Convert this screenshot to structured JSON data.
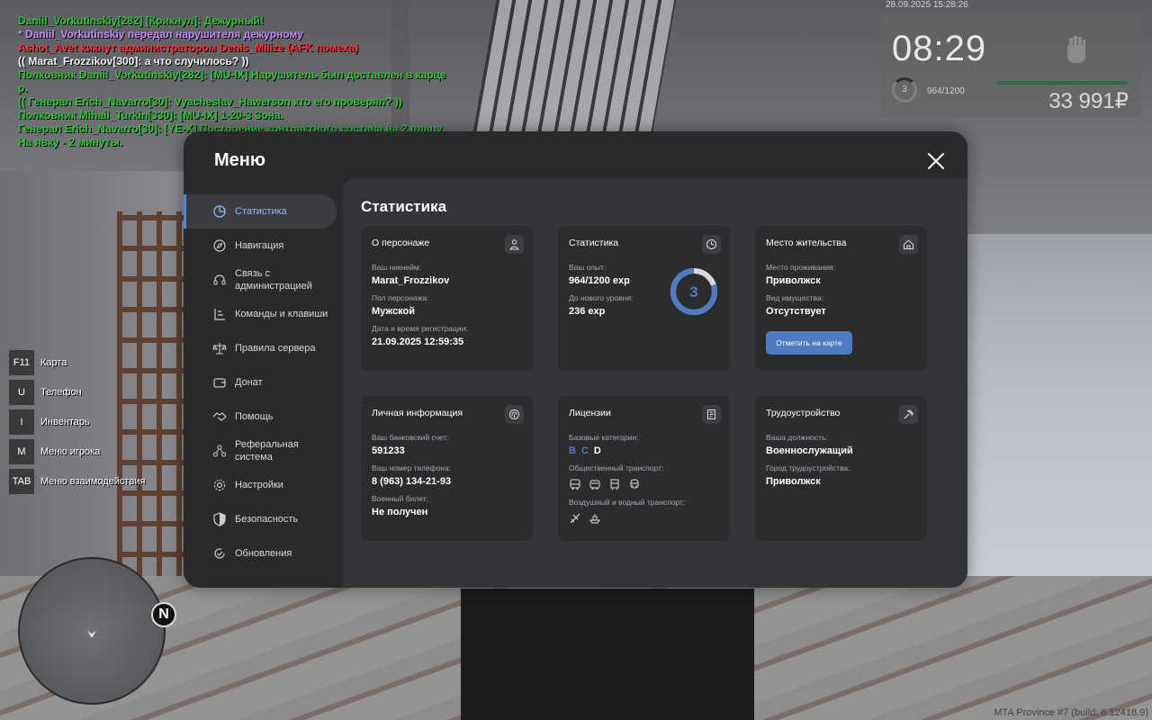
{
  "chat": [
    {
      "text": "Daniil_Vorkutinskiy[282] [Крикнул]: Дежурный!",
      "color": "green"
    },
    {
      "text": "* Daniil_Vorkutinskiy передал нарушителя дежурному",
      "color": "purple"
    },
    {
      "text": "Ashot_Avet кикнут администратором Denis_Milize (AFK помеха)",
      "color": "red"
    },
    {
      "text": "(( Marat_Frozzikov[300]: а что случилось? ))",
      "color": "white"
    },
    {
      "text": "Полковник Daniil_Vorkutinskiy[282]: [MU-IX] Нарушитель был доставлен в карце",
      "color": "green"
    },
    {
      "text": "р.",
      "color": "green"
    },
    {
      "text": "(( Генерал Erich_Navarro[30]: Vyacheslav_Hawerson кто его проверял? ))",
      "color": "green"
    },
    {
      "text": "Полковник Mihail_Turkin[330]: [MU-IX] 1-20-3 Зона.",
      "color": "green"
    },
    {
      "text": "Генерал Erich_Navarro[30]: [YE-X] Построение контрактного состава на 2 плацу.",
      "color": "green"
    },
    {
      "text": " На явку - 2 минуты.",
      "color": "green"
    }
  ],
  "hud": {
    "date": "28.09.2025 15:28:26",
    "time": "08:29",
    "level": "3",
    "exp": "964/1200",
    "money": "33 991₽"
  },
  "keys": [
    {
      "key": "F11",
      "label": "Карта"
    },
    {
      "key": "U",
      "label": "Телефон"
    },
    {
      "key": "I",
      "label": "Инвентарь"
    },
    {
      "key": "M",
      "label": "Меню игрока"
    },
    {
      "key": "TAB",
      "label": "Меню взаимодействия"
    }
  ],
  "minimap": {
    "north": "N"
  },
  "footer": "MTA Province #7 (build: 6.12418.9)",
  "menu": {
    "title": "Меню",
    "nav": [
      {
        "label": "Статистика",
        "icon": "pie-chart-icon"
      },
      {
        "label": "Навигация",
        "icon": "compass-icon"
      },
      {
        "label": "Связь с",
        "label2": "администрацией",
        "icon": "headset-icon"
      },
      {
        "label": "Команды и клавиши",
        "icon": "command-icon"
      },
      {
        "label": "Правила сервера",
        "icon": "scales-icon"
      },
      {
        "label": "Донат",
        "icon": "wallet-icon"
      },
      {
        "label": "Помощь",
        "icon": "handshake-icon"
      },
      {
        "label": "Реферальная",
        "label2": "система",
        "icon": "referral-icon"
      },
      {
        "label": "Настройки",
        "icon": "gear-icon"
      },
      {
        "label": "Безопасность",
        "icon": "shield-icon"
      },
      {
        "label": "Обновления",
        "icon": "refresh-icon"
      }
    ],
    "content_title": "Статистика",
    "about": {
      "title": "О персонаже",
      "nick_label": "Ваш никнейм:",
      "nick": "Marat_Frozzikov",
      "gender_label": "Пол персонажа:",
      "gender": "Мужской",
      "reg_label": "Дата и время регистрации:",
      "reg": "21.09.2025 12:59:35"
    },
    "stats": {
      "title": "Статистика",
      "exp_label": "Ваш опыт:",
      "exp": "964/1200 exp",
      "next_label": "До нового уровня:",
      "next": "236 exp",
      "level": "3",
      "progress": 0.803
    },
    "residence": {
      "title": "Место жительства",
      "place_label": "Место проживания:",
      "place": "Приволжск",
      "property_label": "Вид имущества:",
      "property": "Отсутствует",
      "button": "Отметить на карте"
    },
    "personal": {
      "title": "Личная информация",
      "bank_label": "Ваш банковский счет:",
      "bank": "591233",
      "phone_label": "Ваш номер телефона:",
      "phone": "8 (963) 134-21-93",
      "military_label": "Военный билет:",
      "military": "Не получен"
    },
    "licenses": {
      "title": "Лицензии",
      "base_label": "Базовые категории:",
      "cat_b": "B",
      "cat_c": "C",
      "cat_d": "D",
      "public_label": "Общественный транспорт:",
      "air_label": "Воздушный и водный транспорт:"
    },
    "job": {
      "title": "Трудоустройство",
      "position_label": "Ваша должность:",
      "position": "Военнослужащий",
      "city_label": "Город трудоустройства:",
      "city": "Приволжск"
    }
  },
  "colors": {
    "accent": "#4f7bc0",
    "green": "#31c43a",
    "purple": "#c78cff",
    "red": "#ff3030",
    "white": "#f2f2f2"
  }
}
